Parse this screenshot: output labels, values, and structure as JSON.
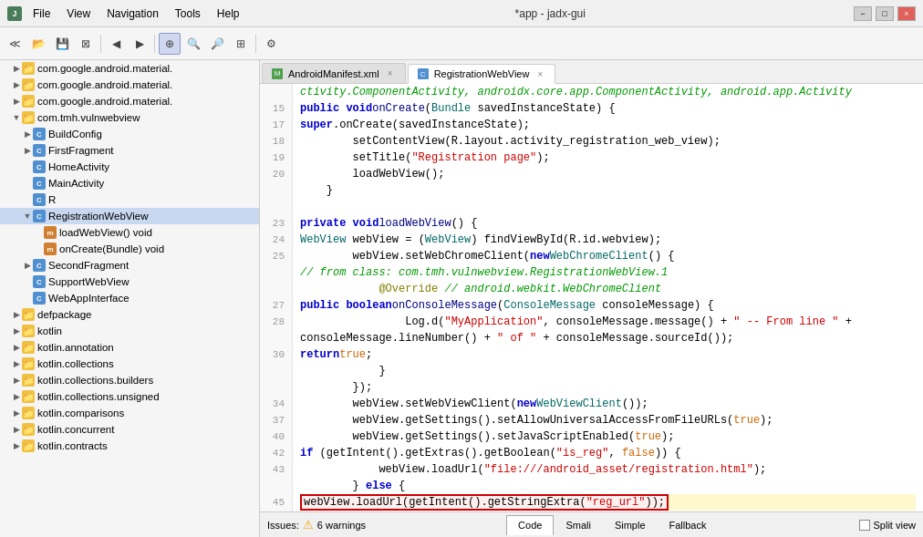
{
  "titleBar": {
    "title": "*app - jadx-gui",
    "menuItems": [
      "File",
      "View",
      "Navigation",
      "Tools",
      "Help"
    ],
    "windowButtons": [
      "−",
      "□",
      "×"
    ]
  },
  "toolbar": {
    "buttons": [
      "≪",
      "⊞",
      "⊡",
      "⊠",
      "→",
      "←",
      "→",
      "|",
      "⊕",
      "⊕",
      "⊕",
      "⊕",
      "|",
      "🔍",
      "🔍",
      "🔍",
      "|",
      "⚙"
    ]
  },
  "sidebar": {
    "items": [
      {
        "indent": 1,
        "arrow": "",
        "icon": "folder",
        "label": "com.google.android.material.",
        "expanded": false
      },
      {
        "indent": 1,
        "arrow": "",
        "icon": "folder",
        "label": "com.google.android.material.",
        "expanded": false
      },
      {
        "indent": 1,
        "arrow": "",
        "icon": "folder",
        "label": "com.google.android.material.",
        "expanded": false
      },
      {
        "indent": 1,
        "arrow": "▼",
        "icon": "folder",
        "label": "com.tmh.vulnwebview",
        "expanded": true
      },
      {
        "indent": 2,
        "arrow": "▶",
        "icon": "class",
        "label": "BuildConfig",
        "expanded": false
      },
      {
        "indent": 2,
        "arrow": "▶",
        "icon": "class",
        "label": "FirstFragment",
        "expanded": false
      },
      {
        "indent": 2,
        "arrow": "",
        "icon": "class",
        "label": "HomeActivity",
        "expanded": false
      },
      {
        "indent": 2,
        "arrow": "",
        "icon": "class",
        "label": "MainActivity",
        "expanded": false
      },
      {
        "indent": 2,
        "arrow": "",
        "icon": "class",
        "label": "R",
        "expanded": false
      },
      {
        "indent": 2,
        "arrow": "▼",
        "icon": "class",
        "label": "RegistrationWebView",
        "expanded": true,
        "selected": true
      },
      {
        "indent": 3,
        "arrow": "",
        "icon": "method",
        "label": "loadWebView() void",
        "expanded": false
      },
      {
        "indent": 3,
        "arrow": "",
        "icon": "method",
        "label": "onCreate(Bundle) void",
        "expanded": false
      },
      {
        "indent": 2,
        "arrow": "▶",
        "icon": "class",
        "label": "SecondFragment",
        "expanded": false
      },
      {
        "indent": 2,
        "arrow": "",
        "icon": "class",
        "label": "SupportWebView",
        "expanded": false
      },
      {
        "indent": 2,
        "arrow": "",
        "icon": "class",
        "label": "WebAppInterface",
        "expanded": false
      },
      {
        "indent": 1,
        "arrow": "▶",
        "icon": "folder",
        "label": "defpackage",
        "expanded": false
      },
      {
        "indent": 1,
        "arrow": "▶",
        "icon": "folder",
        "label": "kotlin",
        "expanded": false
      },
      {
        "indent": 1,
        "arrow": "▶",
        "icon": "folder",
        "label": "kotlin.annotation",
        "expanded": false
      },
      {
        "indent": 1,
        "arrow": "▶",
        "icon": "folder",
        "label": "kotlin.collections",
        "expanded": false
      },
      {
        "indent": 1,
        "arrow": "▶",
        "icon": "folder",
        "label": "kotlin.collections.builders",
        "expanded": false
      },
      {
        "indent": 1,
        "arrow": "▶",
        "icon": "folder",
        "label": "kotlin.collections.unsigned",
        "expanded": false
      },
      {
        "indent": 1,
        "arrow": "▶",
        "icon": "folder",
        "label": "kotlin.comparisons",
        "expanded": false
      },
      {
        "indent": 1,
        "arrow": "▶",
        "icon": "folder",
        "label": "kotlin.concurrent",
        "expanded": false
      },
      {
        "indent": 1,
        "arrow": "▶",
        "icon": "folder",
        "label": "kotlin.contracts",
        "expanded": false
      }
    ]
  },
  "tabs": [
    {
      "label": "AndroidManifest.xml",
      "icon": "manifest",
      "active": false
    },
    {
      "label": "RegistrationWebView",
      "icon": "reg",
      "active": true
    }
  ],
  "codeLines": [
    {
      "num": "",
      "text": "ctivity.ComponentActivity, androidx.core.app.ComponentActivity, android.app.Activity",
      "type": "comment-header"
    },
    {
      "num": "15",
      "text": "        public void onCreate(Bundle savedInstanceState) {",
      "type": "normal"
    },
    {
      "num": "17",
      "text": "            super.onCreate(savedInstanceState);",
      "type": "normal"
    },
    {
      "num": "18",
      "text": "            setContentView(R.layout.activity_registration_web_view);",
      "type": "normal"
    },
    {
      "num": "19",
      "text": "            setTitle(\"Registration page\");",
      "type": "normal"
    },
    {
      "num": "20",
      "text": "            loadWebView();",
      "type": "normal"
    },
    {
      "num": "",
      "text": "        }",
      "type": "normal"
    },
    {
      "num": "",
      "text": "",
      "type": "normal"
    },
    {
      "num": "23",
      "text": "    private void loadWebView() {",
      "type": "normal"
    },
    {
      "num": "24",
      "text": "        WebView webView = (WebView) findViewById(R.id.webview);",
      "type": "normal"
    },
    {
      "num": "25",
      "text": "        webView.setWebChromeClient(new WebChromeClient() {",
      "type": "normal"
    },
    {
      "num": "",
      "text": "// from class: com.tmh.vulnwebview.RegistrationWebView.1",
      "type": "comment"
    },
    {
      "num": "",
      "text": "            @Override // android.webkit.WebChromeClient",
      "type": "annotation"
    },
    {
      "num": "27",
      "text": "            public boolean onConsoleMessage(ConsoleMessage consoleMessage) {",
      "type": "normal"
    },
    {
      "num": "28",
      "text": "                Log.d(\"MyApplication\", consoleMessage.message() + \" -- From line \" +",
      "type": "normal"
    },
    {
      "num": "",
      "text": "consoleMessage.lineNumber() + \" of \" + consoleMessage.sourceId());",
      "type": "normal"
    },
    {
      "num": "30",
      "text": "                return true;",
      "type": "normal"
    },
    {
      "num": "",
      "text": "            }",
      "type": "normal"
    },
    {
      "num": "",
      "text": "        });",
      "type": "normal"
    },
    {
      "num": "34",
      "text": "        webView.setWebViewClient(new WebViewClient());",
      "type": "normal"
    },
    {
      "num": "37",
      "text": "        webView.getSettings().setAllowUniversalAccessFromFileURLs(true);",
      "type": "normal"
    },
    {
      "num": "40",
      "text": "        webView.getSettings().setJavaScriptEnabled(true);",
      "type": "normal"
    },
    {
      "num": "42",
      "text": "        if (getIntent().getExtras().getBoolean(\"is_reg\", false)) {",
      "type": "normal"
    },
    {
      "num": "43",
      "text": "            webView.loadUrl(\"file:///android_asset/registration.html\");",
      "type": "normal"
    },
    {
      "num": "",
      "text": "        } else {",
      "type": "normal"
    },
    {
      "num": "45",
      "text": "            webView.loadUrl(getIntent().getStringExtra(\"reg_url\"));",
      "type": "highlighted"
    },
    {
      "num": "",
      "text": "        }",
      "type": "normal"
    },
    {
      "num": "",
      "text": "    }",
      "type": "normal"
    },
    {
      "num": "",
      "text": "}",
      "type": "normal"
    }
  ],
  "bottomBar": {
    "issuesLabel": "Issues:",
    "warningsCount": "6 warnings",
    "tabs": [
      "Code",
      "Smali",
      "Simple",
      "Fallback"
    ],
    "activeTab": "Code",
    "splitViewLabel": "Split view"
  }
}
